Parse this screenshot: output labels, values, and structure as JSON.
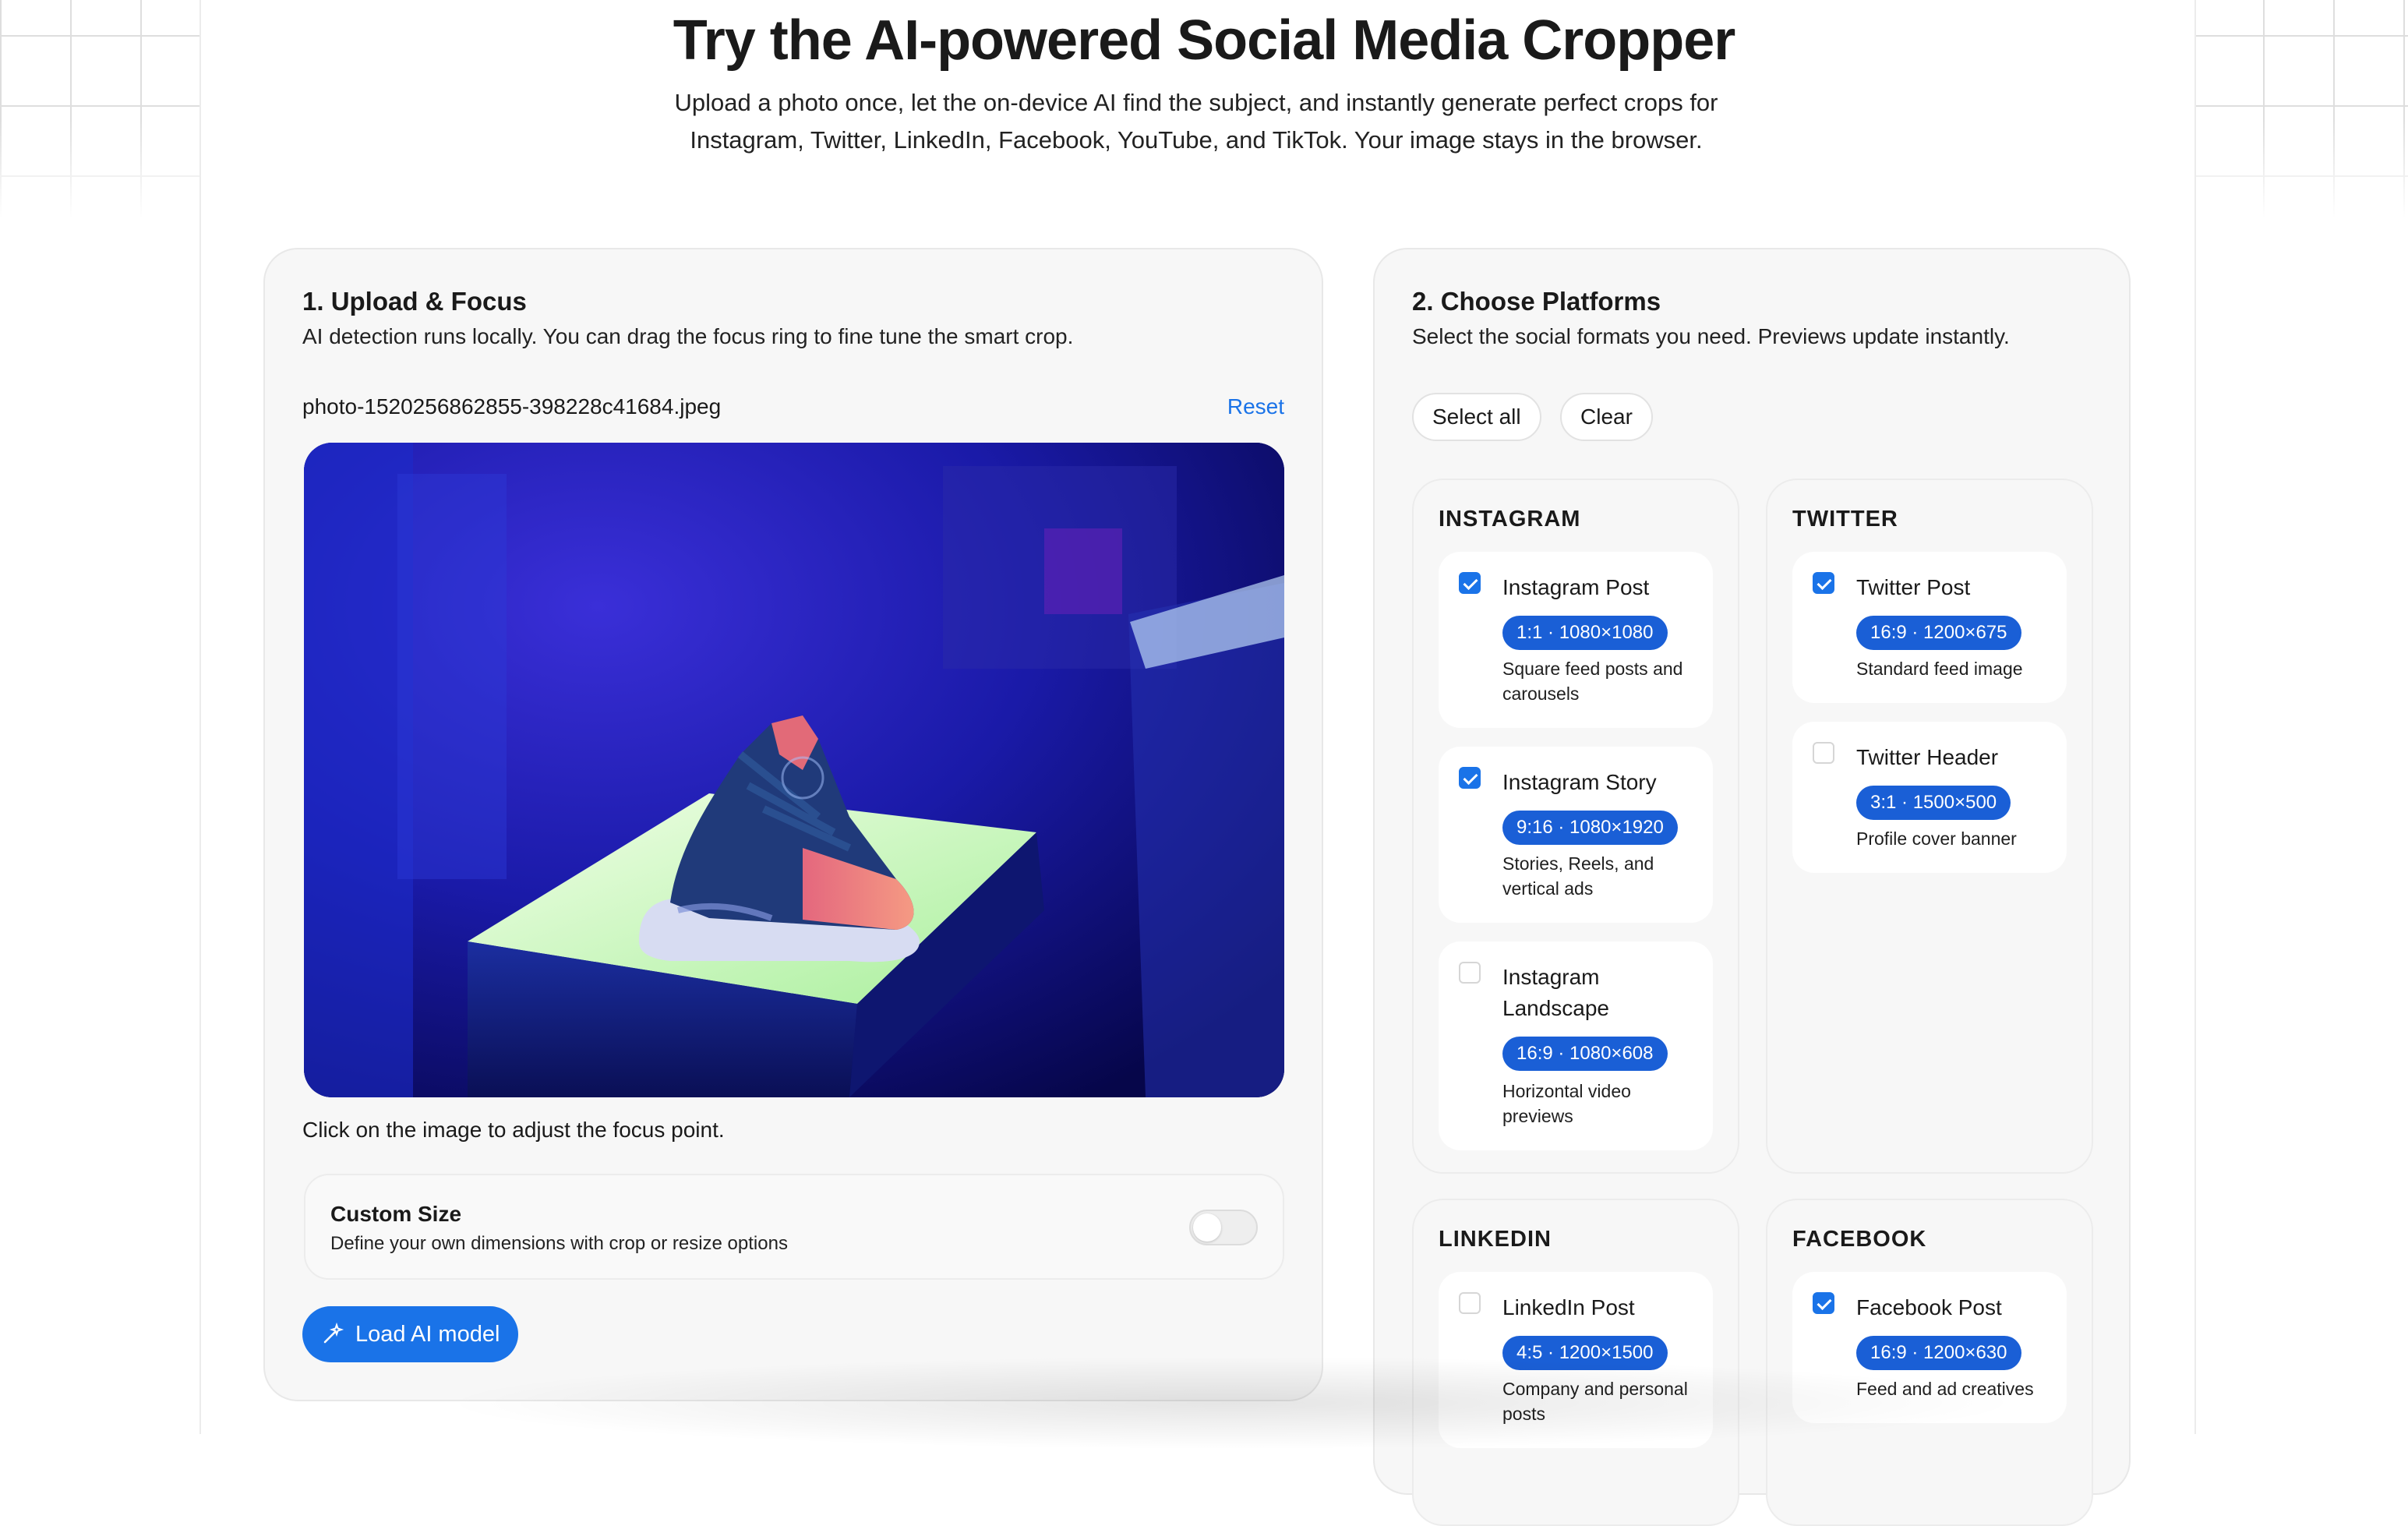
{
  "hero": {
    "title": "Try the AI-powered Social Media Cropper",
    "subtitle": "Upload a photo once, let the on-device AI find the subject, and instantly generate perfect crops for Instagram, Twitter, LinkedIn, Facebook, YouTube, and TikTok. Your image stays in the browser."
  },
  "upload": {
    "title": "1. Upload & Focus",
    "description": "AI detection runs locally. You can drag the focus ring to fine tune the smart crop.",
    "filename": "photo-1520256862855-398228c41684.jpeg",
    "reset_label": "Reset",
    "hint": "Click on the image to adjust the focus point.",
    "custom_size": {
      "title": "Custom Size",
      "description": "Define your own dimensions with crop or resize options",
      "enabled": false
    },
    "load_button": "Load AI model"
  },
  "platforms": {
    "title": "2. Choose Platforms",
    "description": "Select the social formats you need. Previews update instantly.",
    "select_all_label": "Select all",
    "clear_label": "Clear",
    "groups": [
      {
        "name": "INSTAGRAM",
        "items": [
          {
            "name": "Instagram Post",
            "badge": "1:1 · 1080×1080",
            "desc": "Square feed posts and carousels",
            "checked": true
          },
          {
            "name": "Instagram Story",
            "badge": "9:16 · 1080×1920",
            "desc": "Stories, Reels, and vertical ads",
            "checked": true
          },
          {
            "name": "Instagram Landscape",
            "badge": "16:9 · 1080×608",
            "desc": "Horizontal video previews",
            "checked": false
          }
        ]
      },
      {
        "name": "TWITTER",
        "items": [
          {
            "name": "Twitter Post",
            "badge": "16:9 · 1200×675",
            "desc": "Standard feed image",
            "checked": true
          },
          {
            "name": "Twitter Header",
            "badge": "3:1 · 1500×500",
            "desc": "Profile cover banner",
            "checked": false
          }
        ]
      },
      {
        "name": "LINKEDIN",
        "items": [
          {
            "name": "LinkedIn Post",
            "badge": "4:5 · 1200×1500",
            "desc": "Company and personal posts",
            "checked": false
          }
        ]
      },
      {
        "name": "FACEBOOK",
        "items": [
          {
            "name": "Facebook Post",
            "badge": "16:9 · 1200×630",
            "desc": "Feed and ad creatives",
            "checked": true
          }
        ]
      }
    ]
  },
  "colors": {
    "accent": "#1a73e8",
    "badge": "#1a5fd6",
    "card_bg": "#f7f7f7"
  }
}
